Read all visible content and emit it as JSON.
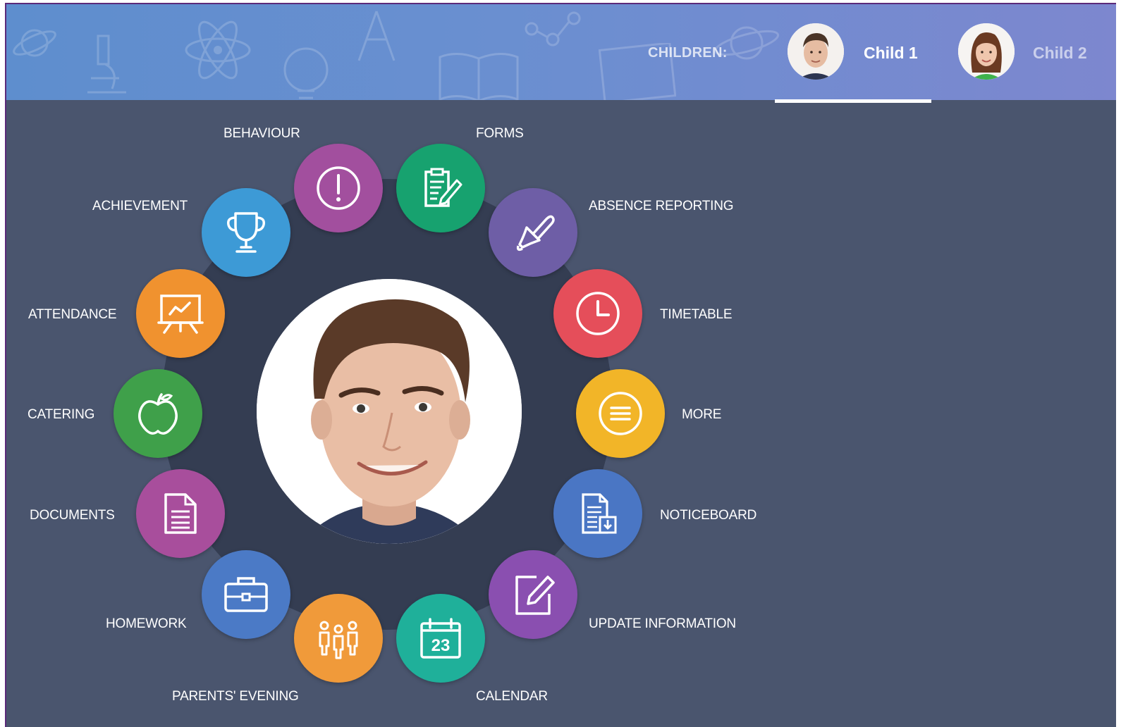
{
  "header": {
    "children_label": "CHILDREN:",
    "children": [
      {
        "name": "Child 1",
        "active": true
      },
      {
        "name": "Child 2",
        "active": false
      }
    ]
  },
  "menu": {
    "behaviour": {
      "label": "BEHAVIOUR",
      "color": "#a24f9e",
      "icon": "exclamation-icon"
    },
    "forms": {
      "label": "FORMS",
      "color": "#17a26f",
      "icon": "form-edit-icon"
    },
    "absence": {
      "label": "ABSENCE REPORTING",
      "color": "#6e5ea6",
      "icon": "bell-icon"
    },
    "timetable": {
      "label": "TIMETABLE",
      "color": "#e54e5a",
      "icon": "clock-icon"
    },
    "more": {
      "label": "MORE",
      "color": "#f2b528",
      "icon": "menu-icon"
    },
    "noticeboard": {
      "label": "NOTICEBOARD",
      "color": "#4a76c4",
      "icon": "notice-download-icon"
    },
    "update": {
      "label": "UPDATE INFORMATION",
      "color": "#8a4fb0",
      "icon": "edit-icon"
    },
    "calendar": {
      "label": "CALENDAR",
      "color": "#1fb09a",
      "icon": "calendar-icon",
      "date": "23"
    },
    "parents": {
      "label": "PARENTS' EVENING",
      "color": "#f09a3a",
      "icon": "people-icon"
    },
    "homework": {
      "label": "HOMEWORK",
      "color": "#4b7ac6",
      "icon": "briefcase-icon"
    },
    "documents": {
      "label": "DOCUMENTS",
      "color": "#a84e9c",
      "icon": "document-icon"
    },
    "catering": {
      "label": "CATERING",
      "color": "#3fa04a",
      "icon": "apple-icon"
    },
    "attendance": {
      "label": "ATTENDANCE",
      "color": "#f0922f",
      "icon": "presentation-chart-icon"
    },
    "achievement": {
      "label": "ACHIEVEMENT",
      "color": "#3d9ad6",
      "icon": "trophy-icon"
    }
  }
}
